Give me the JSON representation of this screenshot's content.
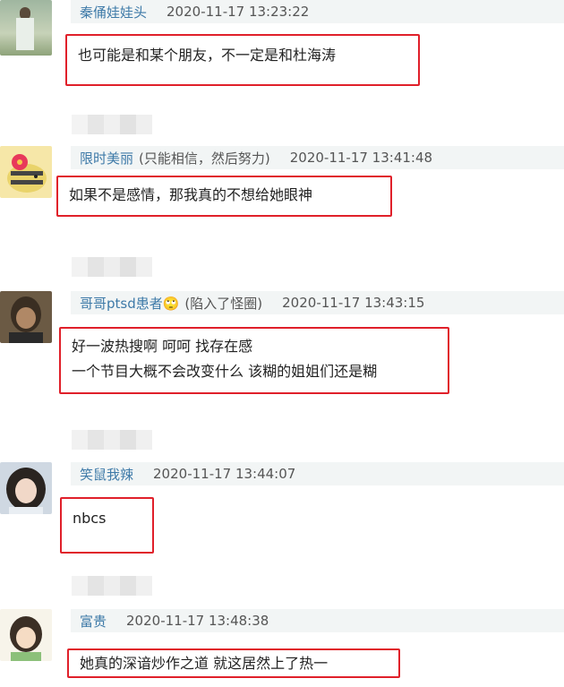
{
  "comments": [
    {
      "username": "秦俑娃娃头",
      "extra": "",
      "time": "2020-11-17 13:23:22",
      "lines": [
        "也可能是和某个朋友，不一定是和杜海涛"
      ]
    },
    {
      "username": "限时美丽",
      "extra": "(只能相信，然后努力)",
      "time": "2020-11-17 13:41:48",
      "lines": [
        "如果不是感情，那我真的不想给她眼神"
      ]
    },
    {
      "username": "哥哥ptsd患者🙄",
      "extra": "(陷入了怪圈)",
      "time": "2020-11-17 13:43:15",
      "lines": [
        "好一波热搜啊 呵呵 找存在感",
        "一个节目大概不会改变什么 该糊的姐姐们还是糊"
      ]
    },
    {
      "username": "笑鼠我辣",
      "extra": "",
      "time": "2020-11-17 13:44:07",
      "lines": [
        "nbcs"
      ]
    },
    {
      "username": "富贵",
      "extra": "",
      "time": "2020-11-17 13:48:38",
      "lines": [
        "她真的深谙炒作之道 就这居然上了热一"
      ]
    }
  ],
  "colors": {
    "username": "#3e7aa8",
    "highlight_border": "#e0202a",
    "header_bg": "#f2f5f5"
  }
}
